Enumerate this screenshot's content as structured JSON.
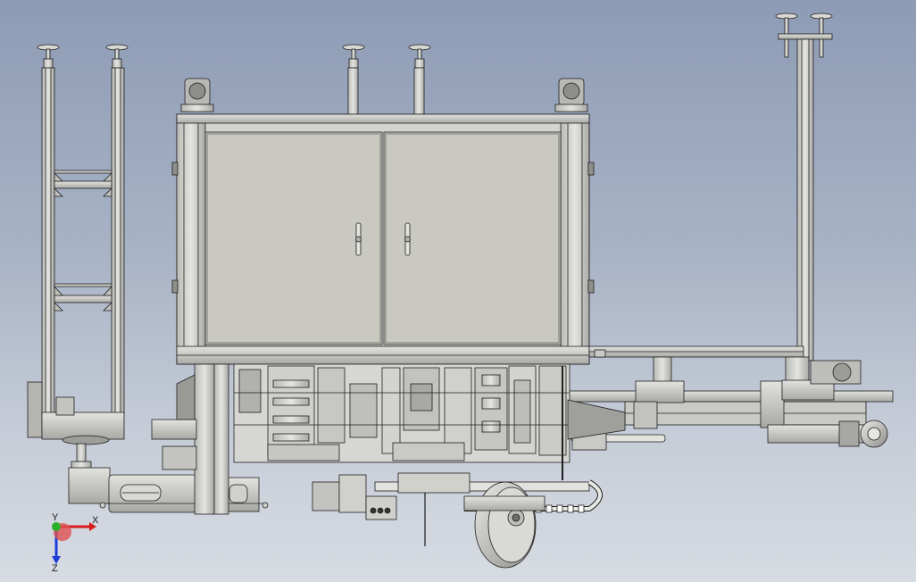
{
  "triad": {
    "x_label": "X",
    "y_label": "Y",
    "z_label": "Z"
  },
  "colors": {
    "background_top": "#8d9bb5",
    "background_bottom": "#d7dbe2",
    "cabinet_panel": "#c9c9c1",
    "frame_metal": "#cfd0cc",
    "line": "#1e1e1e",
    "axis_x": "#d81b1b",
    "axis_y": "#2bb02b",
    "axis_z": "#1b3fd8"
  }
}
